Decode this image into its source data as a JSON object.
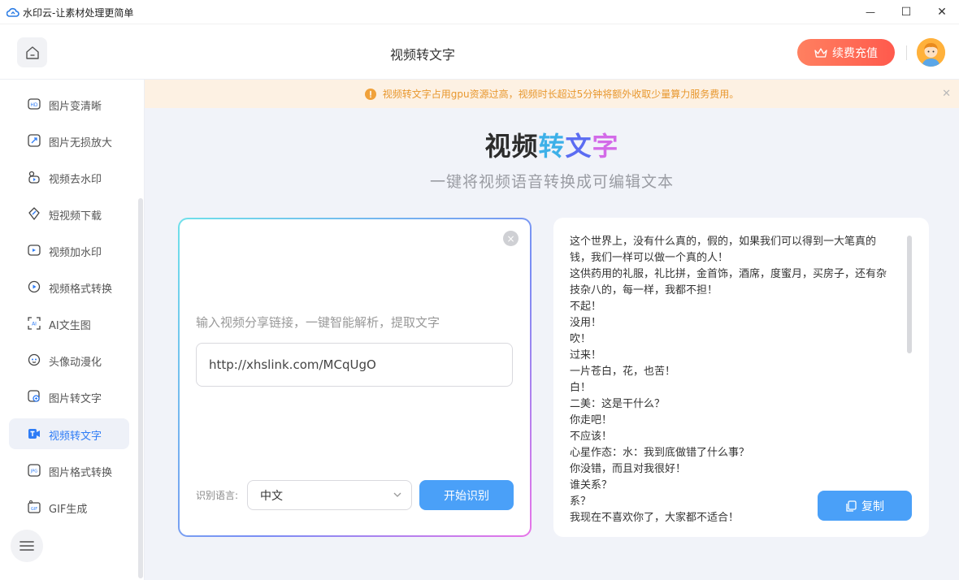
{
  "window": {
    "app_title": "水印云-让素材处理更简单",
    "minimize": "—",
    "maximize": "☐",
    "close": "✕"
  },
  "header": {
    "page_title": "视频转文字",
    "recharge_label": "续费充值"
  },
  "sidebar": {
    "items": [
      {
        "label": "图片变清晰",
        "icon": "hd-icon",
        "active": false
      },
      {
        "label": "图片无损放大",
        "icon": "zoom-expand-icon",
        "active": false
      },
      {
        "label": "视频去水印",
        "icon": "video-watermark-remove-icon",
        "active": false
      },
      {
        "label": "短视频下载",
        "icon": "short-video-download-icon",
        "active": false
      },
      {
        "label": "视频加水印",
        "icon": "video-add-watermark-icon",
        "active": false
      },
      {
        "label": "视频格式转换",
        "icon": "video-format-icon",
        "active": false
      },
      {
        "label": "AI文生图",
        "icon": "ai-image-icon",
        "active": false
      },
      {
        "label": "头像动漫化",
        "icon": "avatar-anime-icon",
        "active": false
      },
      {
        "label": "图片转文字",
        "icon": "image-to-text-icon",
        "active": false
      },
      {
        "label": "视频转文字",
        "icon": "video-to-text-icon",
        "active": true
      },
      {
        "label": "图片格式转换",
        "icon": "image-format-icon",
        "active": false
      },
      {
        "label": "GIF生成",
        "icon": "gif-icon",
        "active": false
      }
    ]
  },
  "notice": {
    "text": "视频转文字占用gpu资源过高，视频时长超过5分钟将额外收取少量算力服务费用。",
    "close": "✕"
  },
  "hero": {
    "title_part1": "视频",
    "title_part2": "转",
    "title_part3": "文",
    "title_part4": "字",
    "subtitle": "一键将视频语音转换成可编辑文本"
  },
  "input_card": {
    "close": "×",
    "hint": "输入视频分享链接，一键智能解析，提取文字",
    "url_value": "http://xhslink.com/MCqUgO",
    "language_label": "识别语言:",
    "language_value": "中文",
    "start_label": "开始识别"
  },
  "result_card": {
    "lines": [
      "这个世界上，没有什么真的，假的，如果我们可以得到一大笔真的",
      "钱，我们一样可以做一个真的人！",
      "这供药用的礼服，礼比拼，金首饰，酒席，度蜜月，买房子，还有杂",
      "技杂八的，每一样，我都不担！",
      "不起！",
      "没用！",
      "吹！",
      "过来！",
      "一片苍白，花，也苦！",
      "白！",
      "二美：这是干什么？",
      "你走吧！",
      "不应该！",
      "心星作态：水：我到底做错了什么事？",
      "你没错，而且对我很好！",
      "谁关系？",
      "系？",
      "我现在不喜欢你了，大家都不适合！"
    ],
    "copy_label": "复制"
  },
  "colors": {
    "accent": "#4aa0f8",
    "active_text": "#2e7cf6",
    "notice_text": "#e8972d",
    "recharge": "#ff5a4d"
  }
}
